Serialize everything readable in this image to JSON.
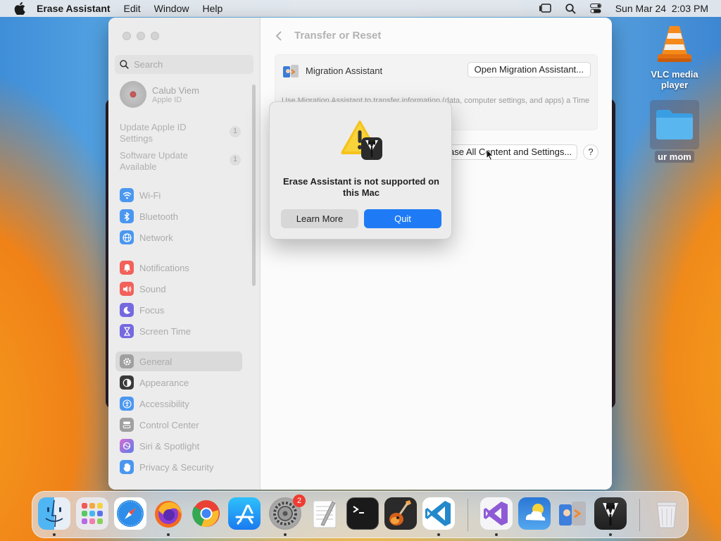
{
  "menubar": {
    "app_name": "Erase Assistant",
    "items": [
      "Edit",
      "Window",
      "Help"
    ],
    "datetime": "Sun Mar 24  2:03 PM"
  },
  "desktop": {
    "icons": [
      {
        "label": "VLC media player",
        "icon": "vlc-cone-icon"
      },
      {
        "label": "ur mom",
        "icon": "folder-icon"
      }
    ]
  },
  "settings_window": {
    "search_placeholder": "Search",
    "profile": {
      "name": "Calub Viem",
      "subtitle": "Apple ID"
    },
    "notifications": [
      {
        "label": "Update Apple ID Settings",
        "count": "1"
      },
      {
        "label": "Software Update Available",
        "count": "1"
      }
    ],
    "sidebar_groups": [
      [
        {
          "label": "Wi-Fi",
          "icon": "wifi-icon",
          "color": "#3b8ff5"
        },
        {
          "label": "Bluetooth",
          "icon": "bluetooth-icon",
          "color": "#3b8ff5"
        },
        {
          "label": "Network",
          "icon": "globe-icon",
          "color": "#3b8ff5"
        }
      ],
      [
        {
          "label": "Notifications",
          "icon": "bell-icon",
          "color": "#f0534b"
        },
        {
          "label": "Sound",
          "icon": "speaker-icon",
          "color": "#f0534b"
        },
        {
          "label": "Focus",
          "icon": "moon-icon",
          "color": "#6a5ed9"
        },
        {
          "label": "Screen Time",
          "icon": "hourglass-icon",
          "color": "#6a5ed9"
        }
      ],
      [
        {
          "label": "General",
          "icon": "gear-icon",
          "color": "#9a9a9a",
          "active": true
        },
        {
          "label": "Appearance",
          "icon": "appearance-icon",
          "color": "#333333"
        },
        {
          "label": "Accessibility",
          "icon": "accessibility-icon",
          "color": "#3b8ff5"
        },
        {
          "label": "Control Center",
          "icon": "control-center-icon",
          "color": "#9a9a9a"
        },
        {
          "label": "Siri & Spotlight",
          "icon": "siri-icon",
          "color": "#c94fc9"
        },
        {
          "label": "Privacy & Security",
          "icon": "hand-icon",
          "color": "#3b8ff5"
        }
      ]
    ],
    "title": "Transfer or Reset",
    "migration": {
      "label": "Migration Assistant",
      "button": "Open Migration Assistant...",
      "description": "Use Migration Assistant to transfer information (data, computer settings, and apps) a Time Machine backup, or disk. You another Mac."
    },
    "erase_button": "Erase All Content and Settings...",
    "help": "?"
  },
  "alert": {
    "message": "Erase Assistant is not supported on this Mac",
    "secondary_button": "Learn More",
    "primary_button": "Quit"
  },
  "dock": {
    "apps": [
      {
        "name": "Finder",
        "icon": "finder-icon",
        "running": true
      },
      {
        "name": "Launchpad",
        "icon": "launchpad-icon",
        "running": false
      },
      {
        "name": "Safari",
        "icon": "safari-icon",
        "running": false
      },
      {
        "name": "Firefox",
        "icon": "firefox-icon",
        "running": true
      },
      {
        "name": "Chrome",
        "icon": "chrome-icon",
        "running": false
      },
      {
        "name": "App Store",
        "icon": "app-store-icon",
        "running": false
      },
      {
        "name": "System Settings",
        "icon": "system-settings-icon",
        "running": true,
        "badge": "2"
      },
      {
        "name": "TextEdit",
        "icon": "textedit-icon",
        "running": false
      },
      {
        "name": "Terminal",
        "icon": "terminal-icon",
        "running": false
      },
      {
        "name": "GarageBand",
        "icon": "garageband-icon",
        "running": false
      },
      {
        "name": "Visual Studio Code",
        "icon": "vscode-icon",
        "running": true
      },
      {
        "name": "Visual Studio",
        "icon": "visual-studio-icon",
        "running": true
      },
      {
        "name": "Weather",
        "icon": "weather-icon",
        "running": false
      },
      {
        "name": "Migration Assistant",
        "icon": "migration-assistant-icon",
        "running": false
      },
      {
        "name": "Erase Assistant",
        "icon": "erase-assistant-icon",
        "running": true
      },
      {
        "name": "Trash",
        "icon": "trash-icon",
        "running": false
      }
    ]
  }
}
